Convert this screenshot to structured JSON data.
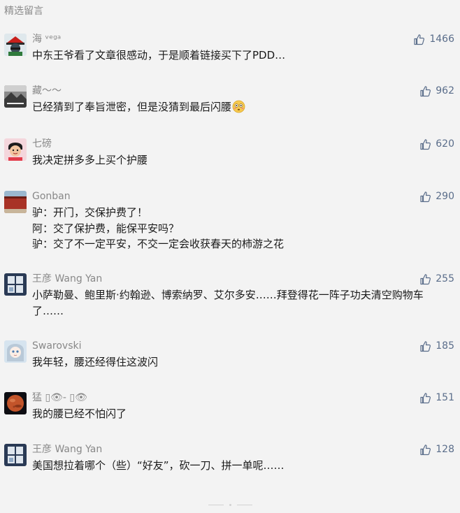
{
  "section": {
    "title": "精选留言"
  },
  "colors": {
    "like": "#5a6d8a",
    "nickname": "#888888",
    "text": "#1a1a1a",
    "background": "#f3f3f3"
  },
  "comments": [
    {
      "nickname": "海 ⸪⸫⸬",
      "nickname_display": "海 ᵛᵉᵍᵃ",
      "likes": "1466",
      "lines": [
        "中东王爷看了文章很感动，于是顺着链接买下了PDD…"
      ],
      "avatar_icon": "red-hat-avatar-icon"
    },
    {
      "nickname": "藏～～",
      "likes": "962",
      "lines": [
        "已经猜到了奉旨泄密，但是没猜到最后闪腰"
      ],
      "emoji_icon": "flushed-face-emoji-icon",
      "avatar_icon": "landscape-bw-avatar-icon"
    },
    {
      "nickname": "七磅",
      "likes": "620",
      "lines": [
        "我决定拼多多上买个护腰"
      ],
      "avatar_icon": "cartoon-person-avatar-icon"
    },
    {
      "nickname": "Gonban",
      "likes": "290",
      "lines": [
        "驴：开门，交保护费了！",
        "阿：交了保护费，能保平安吗？",
        "驴：交了不一定平安，不交一定会收获春天的柿游之花"
      ],
      "avatar_icon": "red-wall-avatar-icon"
    },
    {
      "nickname": "王彦 Wang Yan",
      "likes": "255",
      "lines": [
        "小萨勒曼、鲍里斯·约翰逊、博索纳罗、艾尔多安……拜登得花一阵子功夫清空购物车了……"
      ],
      "wrap": true,
      "avatar_icon": "window-view-avatar-icon"
    },
    {
      "nickname": "Swarovski",
      "likes": "185",
      "lines": [
        "我年轻，腰还经得住这波闪"
      ],
      "avatar_icon": "anime-girl-avatar-icon"
    },
    {
      "nickname": "猛 ▯👁- ▯👁",
      "likes": "151",
      "lines": [
        "我的腰已经不怕闪了"
      ],
      "avatar_icon": "mars-planet-avatar-icon"
    },
    {
      "nickname": "王彦 Wang Yan",
      "likes": "128",
      "lines": [
        "美国想拉着哪个（些）“好友”，砍一刀、拼一单呢……"
      ],
      "avatar_icon": "window-view-avatar-icon"
    }
  ]
}
